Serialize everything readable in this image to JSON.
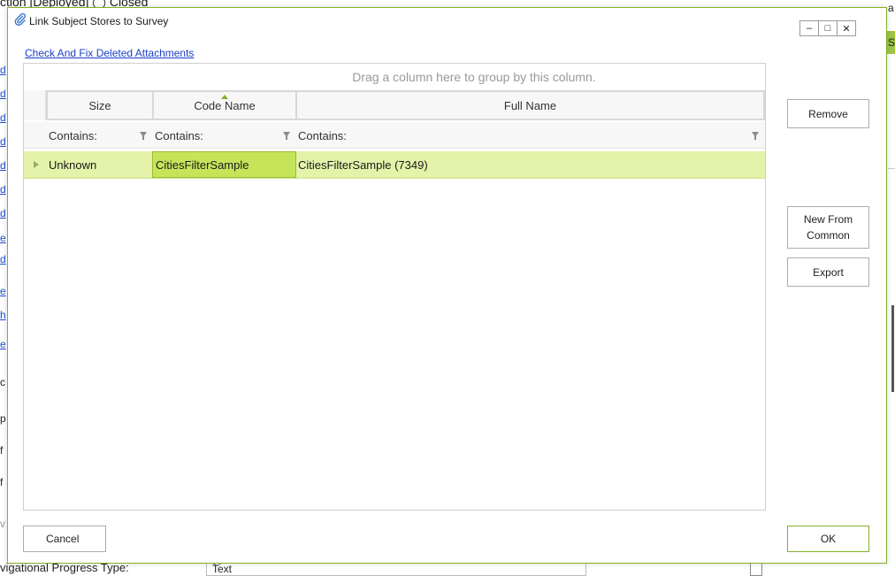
{
  "background": {
    "top_text": "ction [Deployed]      ◯ Closed",
    "left_link_letters": [
      "d",
      "d",
      "d",
      "d",
      "d",
      "d",
      "d",
      "e",
      "d",
      "e",
      "h",
      "e"
    ],
    "left_plain_letters": [
      "c",
      "p",
      "f",
      "f",
      "v"
    ],
    "right_text": "a",
    "right_green_text": "S",
    "bottom_label": "vigational Progress Type:",
    "bottom_field_value": "Text"
  },
  "dialog": {
    "title": "Link Subject Stores to Survey",
    "window_buttons": {
      "minimize": "–",
      "maximize": "□",
      "close": "✕"
    },
    "link": "Check And Fix Deleted Attachments",
    "grid": {
      "group_panel_text": "Drag a column here to group by this column.",
      "columns": [
        "Size",
        "Code Name",
        "Full Name"
      ],
      "sorted_column": "Code Name",
      "filters": [
        "Contains:",
        "Contains:",
        "Contains:"
      ],
      "rows": [
        {
          "size": "Unknown",
          "code_name": "CitiesFilterSample",
          "full_name": "CitiesFilterSample (7349)"
        }
      ]
    },
    "buttons": {
      "remove": "Remove",
      "new_from_common": "New From Common",
      "export": "Export",
      "cancel": "Cancel",
      "ok": "OK"
    },
    "accent_color": "#86b02a",
    "selected_row_color": "#e4f3a9"
  }
}
